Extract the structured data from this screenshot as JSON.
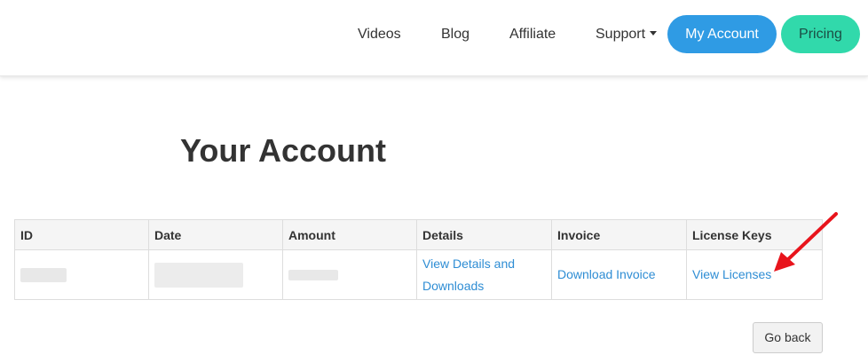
{
  "nav": {
    "videos": "Videos",
    "blog": "Blog",
    "affiliate": "Affiliate",
    "support": "Support",
    "my_account": "My Account",
    "pricing": "Pricing"
  },
  "page": {
    "title": "Your Account"
  },
  "table": {
    "headers": [
      "ID",
      "Date",
      "Amount",
      "Details",
      "Invoice",
      "License Keys"
    ],
    "rows": [
      {
        "details_link": "View Details and Downloads",
        "invoice_link": "Download Invoice",
        "license_link": "View Licenses"
      }
    ]
  },
  "actions": {
    "go_back": "Go back"
  },
  "colors": {
    "my_account_bg": "#2f9be4",
    "pricing_bg": "#31d9ab",
    "link": "#2e8dd4",
    "annotation_arrow": "#e8141c"
  }
}
